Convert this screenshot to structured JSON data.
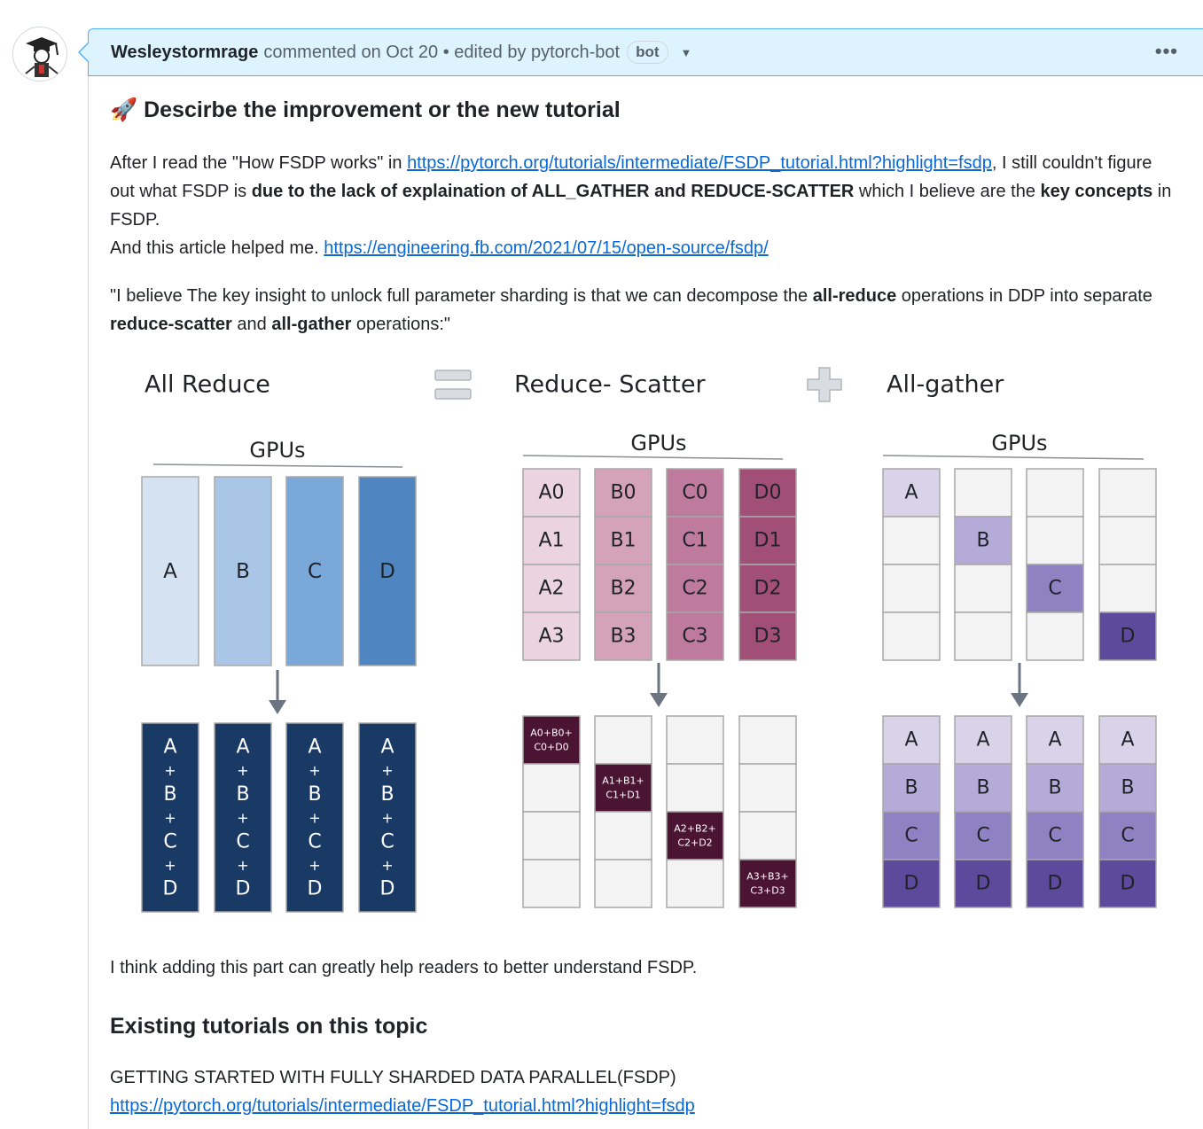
{
  "comment": {
    "author": "Wesleystormrage",
    "action": "commented on Oct 20 • edited by pytorch-bot",
    "bot_badge": "bot",
    "menu": "•••"
  },
  "body": {
    "heading_emoji": "🚀",
    "heading": "Descirbe the improvement or the new tutorial",
    "p1_a": "After I read the \"How FSDP works\" in ",
    "p1_link": "https://pytorch.org/tutorials/intermediate/FSDP_tutorial.html?highlight=fsdp",
    "p1_b": ", I still couldn't figure out what FSDP is ",
    "p1_bold1": "due to the lack of explaination of ALL_GATHER and REDUCE-SCATTER",
    "p1_c": " which I believe are the ",
    "p1_bold2": "key concepts",
    "p1_d": " in FSDP.",
    "p2_a": "And this article helped me. ",
    "p2_link": "https://engineering.fb.com/2021/07/15/open-source/fsdp/",
    "p3_a": "\"I believe The key insight to unlock full parameter sharding is that we can decompose the ",
    "p3_b1": "all-reduce",
    "p3_b": " operations in DDP into separate ",
    "p3_b2": "reduce-scatter",
    "p3_c": " and ",
    "p3_b3": "all-gather",
    "p3_d": " operations:\"",
    "p4": "I think adding this part can greatly help readers to better understand FSDP.",
    "heading2": "Existing tutorials on this topic",
    "p5": "GETTING STARTED WITH FULLY SHARDED DATA PARALLEL(FSDP)",
    "p5_link": "https://pytorch.org/tutorials/intermediate/FSDP_tutorial.html?highlight=fsdp"
  },
  "figure": {
    "titles": [
      "All Reduce",
      "Reduce- Scatter",
      "All-gather"
    ],
    "gpus_label": "GPUs",
    "all_reduce_top": [
      "A",
      "B",
      "C",
      "D"
    ],
    "all_reduce_top_colors": [
      "#d5e2f2",
      "#a9c6e7",
      "#7aa8d8",
      "#4f85c1"
    ],
    "all_reduce_bottom": [
      "A",
      "+",
      "B",
      "+",
      "C",
      "+",
      "D"
    ],
    "all_reduce_bottom_color": "#1a3a66",
    "rs_top": [
      [
        "A0",
        "A1",
        "A2",
        "A3"
      ],
      [
        "B0",
        "B1",
        "B2",
        "B3"
      ],
      [
        "C0",
        "C1",
        "C2",
        "C3"
      ],
      [
        "D0",
        "D1",
        "D2",
        "D3"
      ]
    ],
    "rs_top_colors": [
      "#ebd3df",
      "#d4a3b9",
      "#bf7b9d",
      "#a14f76"
    ],
    "rs_bottom": [
      [
        "A0+B0+",
        "C0+D0"
      ],
      [
        "A1+B1+",
        "C1+D1"
      ],
      [
        "A2+B2+",
        "C2+D2"
      ],
      [
        "A3+B3+",
        "C3+D3"
      ]
    ],
    "rs_bottom_color": "#4a1432",
    "ag_labels": [
      "A",
      "B",
      "C",
      "D"
    ],
    "ag_colors": [
      "#d9d3ea",
      "#b5abd8",
      "#8f82c2",
      "#5e4a9c"
    ],
    "empty_color": "#f3f3f3",
    "border_color": "#a8a8a8"
  }
}
